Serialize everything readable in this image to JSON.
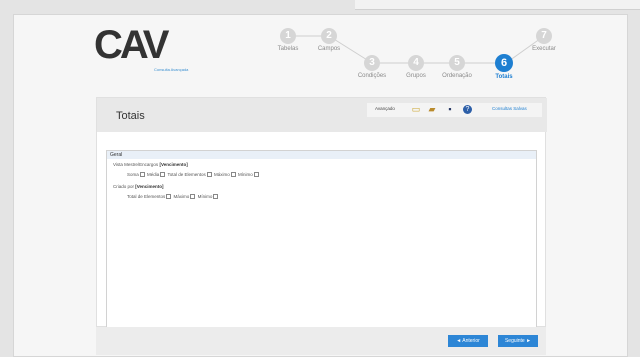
{
  "logo": {
    "text": "CAV",
    "subtitle": "Consulta Avançada"
  },
  "wizard": {
    "steps": [
      {
        "num": "1",
        "label": "Tabelas"
      },
      {
        "num": "2",
        "label": "Campos"
      },
      {
        "num": "3",
        "label": "Condições"
      },
      {
        "num": "4",
        "label": "Grupos"
      },
      {
        "num": "5",
        "label": "Ordenação"
      },
      {
        "num": "6",
        "label": "Totais"
      },
      {
        "num": "7",
        "label": "Executar"
      }
    ],
    "active_step": "6"
  },
  "panel": {
    "title": "Totais",
    "toolbar": {
      "label": "Avançado",
      "link": "Consultas Salvas"
    },
    "group": "Geral",
    "row1": {
      "text": "Vista Mestre/Encargos",
      "bold": "[Vencimento]"
    },
    "row1_options": [
      "Soma",
      "Média",
      "Total de Elementos",
      "Máximo",
      "Mínimo"
    ],
    "row2": {
      "text": "Criado por",
      "bold": "[Vencimento]"
    },
    "row2_options": [
      "Total de Elementos",
      "Máximo",
      "Mínimo"
    ]
  },
  "footer": {
    "prev_label": "◄ Anterior",
    "next_label": "Seguinte ►"
  }
}
